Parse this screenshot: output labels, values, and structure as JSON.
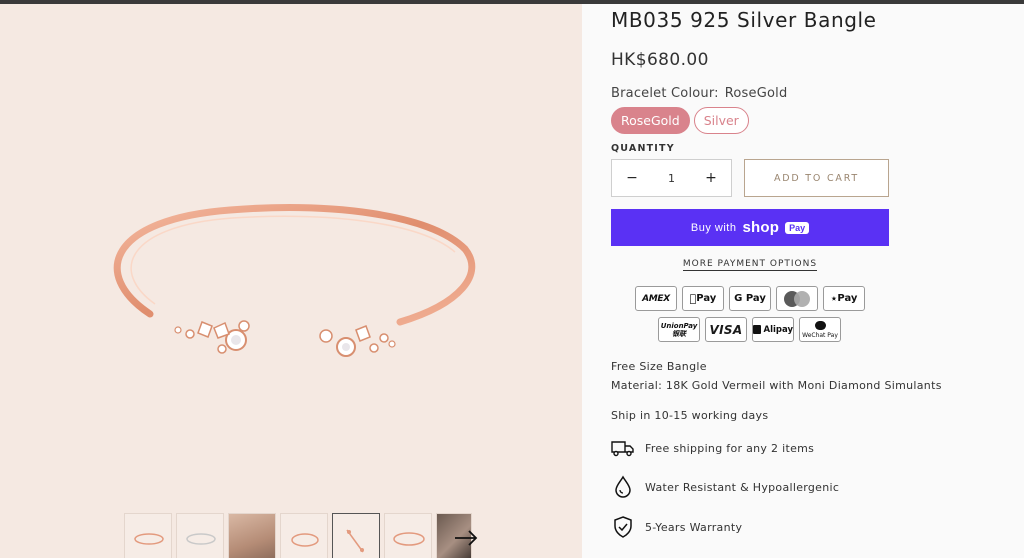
{
  "product": {
    "title": "MB035 925 Silver Bangle",
    "price": "HK$680.00"
  },
  "variant": {
    "label": "Bracelet Colour:",
    "selected": "RoseGold",
    "options": [
      "RoseGold",
      "Silver"
    ]
  },
  "quantity": {
    "label": "QUANTITY",
    "value": "1",
    "minus": "−",
    "plus": "+"
  },
  "cart": {
    "add_label": "ADD TO CART"
  },
  "shop_pay": {
    "prefix": "Buy with",
    "brand": "shop",
    "tag": "Pay"
  },
  "more_payment_label": "MORE PAYMENT OPTIONS",
  "payment_methods": {
    "amex": "AMEX",
    "apple_pay": "Pay",
    "google_pay": "G Pay",
    "opay": "Pay",
    "unionpay_1": "UnionPay",
    "unionpay_2": "银联",
    "visa": "VISA",
    "alipay": "Alipay",
    "wechat": "WeChat Pay"
  },
  "description": {
    "line1": "Free Size Bangle",
    "line2": "Material: 18K Gold Vermeil with Moni Diamond Simulants",
    "ship": "Ship in 10-15 working days"
  },
  "features": [
    {
      "icon": "truck-icon",
      "text": "Free shipping for any 2 items"
    },
    {
      "icon": "water-drop-icon",
      "text": "Water Resistant & Hypoallergenic"
    },
    {
      "icon": "shield-check-icon",
      "text": "5-Years Warranty"
    }
  ],
  "colors": {
    "accent_rose": "#d9838c",
    "shop_pay": "#5a31f4",
    "gallery_bg": "#f5e9e2",
    "bangle": "#e89a7c"
  }
}
